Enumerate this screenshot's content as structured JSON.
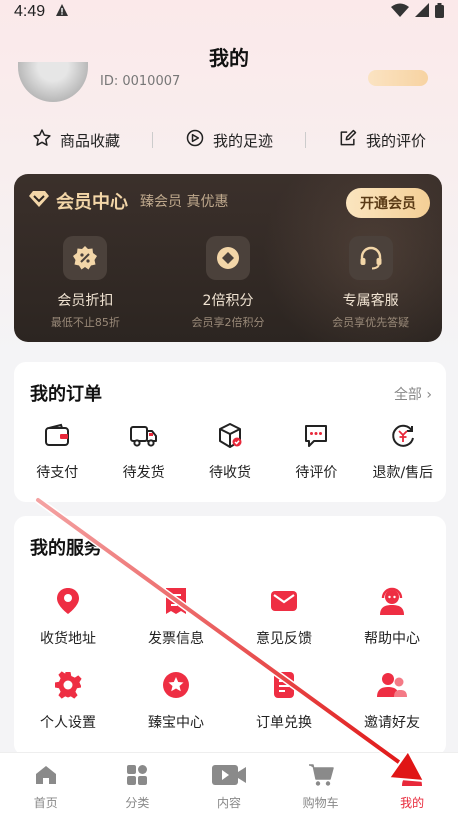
{
  "status_bar": {
    "time": "4:49"
  },
  "header": {
    "title": "我的"
  },
  "profile": {
    "id_text": "ID: 0010007"
  },
  "quick_links": [
    {
      "label": "商品收藏",
      "icon": "star-outline-icon"
    },
    {
      "label": "我的足迹",
      "icon": "footprint-icon"
    },
    {
      "label": "我的评价",
      "icon": "edit-review-icon"
    }
  ],
  "vip": {
    "title": "会员中心",
    "subtitle": "臻会员 真优惠",
    "button": "开通会员",
    "perks": [
      {
        "name": "会员折扣",
        "desc": "最低不止85折",
        "icon": "discount-badge-icon"
      },
      {
        "name": "2倍积分",
        "desc": "会员享2倍积分",
        "icon": "points-icon"
      },
      {
        "name": "专属客服",
        "desc": "会员享优先答疑",
        "icon": "headset-icon"
      }
    ]
  },
  "orders": {
    "title": "我的订单",
    "all_label": "全部 ›",
    "items": [
      {
        "label": "待支付",
        "icon": "wallet-icon"
      },
      {
        "label": "待发货",
        "icon": "truck-icon"
      },
      {
        "label": "待收货",
        "icon": "package-icon"
      },
      {
        "label": "待评价",
        "icon": "comment-icon"
      },
      {
        "label": "退款/售后",
        "icon": "refund-icon"
      }
    ]
  },
  "services": {
    "title": "我的服务",
    "items": [
      {
        "label": "收货地址",
        "icon": "location-pin-icon"
      },
      {
        "label": "发票信息",
        "icon": "invoice-icon"
      },
      {
        "label": "意见反馈",
        "icon": "mail-icon"
      },
      {
        "label": "帮助中心",
        "icon": "support-agent-icon"
      },
      {
        "label": "个人设置",
        "icon": "gear-icon"
      },
      {
        "label": "臻宝中心",
        "icon": "star-circle-icon"
      },
      {
        "label": "订单兑换",
        "icon": "exchange-doc-icon"
      },
      {
        "label": "邀请好友",
        "icon": "invite-users-icon"
      }
    ]
  },
  "tabs": [
    {
      "label": "首页",
      "icon": "home-icon"
    },
    {
      "label": "分类",
      "icon": "category-grid-icon"
    },
    {
      "label": "内容",
      "icon": "video-icon"
    },
    {
      "label": "购物车",
      "icon": "cart-icon"
    },
    {
      "label": "我的",
      "icon": "user-icon",
      "active": true
    }
  ],
  "colors": {
    "accent": "#e8283a",
    "vip_gold": "#f3d6a8",
    "vip_bg": "#2c2521"
  }
}
